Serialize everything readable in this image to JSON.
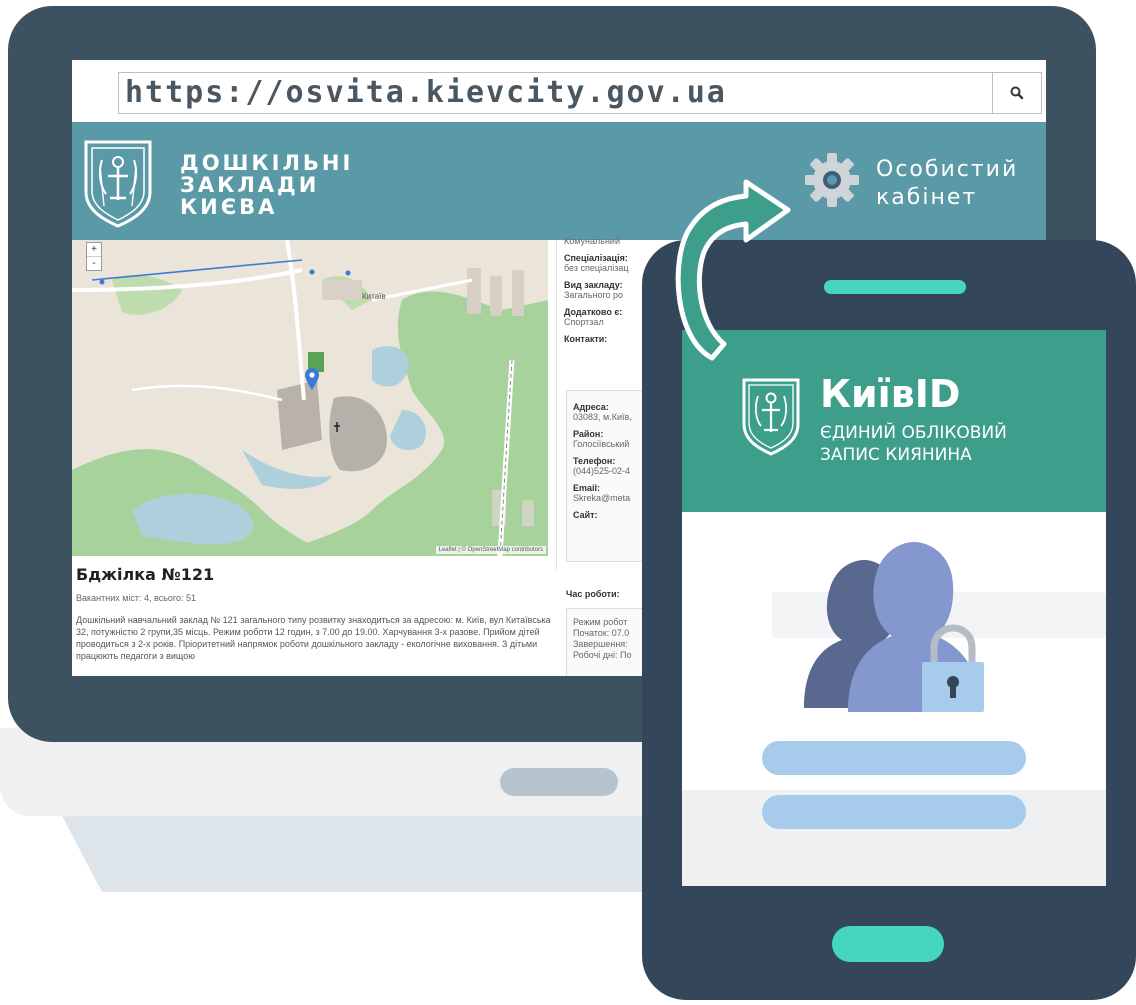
{
  "browser": {
    "url": "https://osvita.kievcity.gov.ua"
  },
  "site": {
    "title_lines": [
      "ДОШКІЛЬНІ",
      "ЗАКЛАДИ",
      "КИЄВА"
    ],
    "cabinet_lines": [
      "Особистий",
      "кабінет"
    ]
  },
  "map": {
    "zoom_in": "+",
    "zoom_out": "-",
    "attribution": "Leaflet | © OpenStreetMap contributors",
    "place_label": "Китаїв"
  },
  "info": {
    "ownership_value": "Комунальний",
    "specialization_label": "Спеціалізація:",
    "specialization_value": "без спеціалізац",
    "type_label": "Вид закладу:",
    "type_value": "Загального ро",
    "extra_label": "Додатково є:",
    "extra_value": "Спортзал",
    "contacts_label": "Контакти:",
    "address_label": "Адреса:",
    "address_value": "03083, м.Київ,",
    "district_label": "Район:",
    "district_value": "Голосіївський",
    "phone_label": "Телефон:",
    "phone_value": "(044)525-02-4",
    "email_label": "Email:",
    "email_value": "Skreka@meta",
    "site_label": "Сайт:",
    "worktime_label": "Час роботи:",
    "worktime_lines": [
      "Режим робот",
      "Початок: 07.0",
      "Завершення:",
      "Робочі дні: По"
    ]
  },
  "kindergarten": {
    "title": "Бджілка №121",
    "vacancies": "Вакантних міст: 4, всього: 51",
    "description": "Дошкільний навчальний заклад № 121 загального типу розвитку знаходиться за адресою: м. Київ, вул Китаївська 32, потужністю 2 групи,35 місць. Режим роботи 12 годин, з 7.00 до 19.00. Харчування 3-х разове. Прийом дітей проводиться з 2-х років. Пріоритетний напрямок роботи дошкільного закладу - екологічне виховання. З дітьми працюють педагоги з вищою"
  },
  "kyivid": {
    "title": "КиївID",
    "subtitle_lines": [
      "ЄДИНИЙ ОБЛІКОВИЙ",
      "ЗАПИС КИЯНИНА"
    ]
  },
  "colors": {
    "bezel": "#3d5260",
    "site_header": "#5a99a6",
    "kyivid_header": "#3d9e8c",
    "accent_mint": "#45d6bd",
    "field": "#a7cbea",
    "user_front": "#8497cf",
    "user_back": "#59688f",
    "lock": "#a7cbea"
  },
  "icons": [
    "search-icon",
    "gear-icon",
    "crest-icon",
    "arrow-icon",
    "users-icon",
    "lock-icon",
    "map-pin-icon"
  ]
}
